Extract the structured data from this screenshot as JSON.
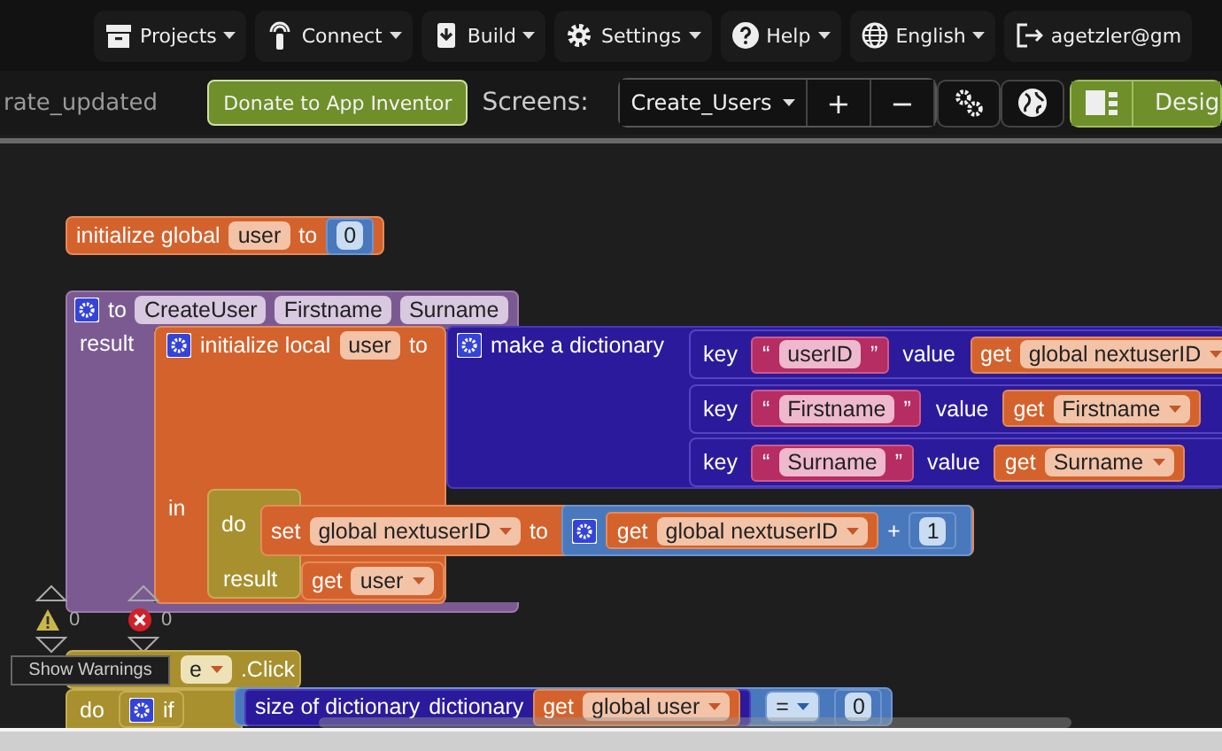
{
  "menu": [
    {
      "label": "Projects",
      "kind": "box"
    },
    {
      "label": "Connect",
      "kind": "antenna"
    },
    {
      "label": "Build",
      "kind": "download"
    },
    {
      "label": "Settings",
      "kind": "gear"
    },
    {
      "label": "Help",
      "kind": "help"
    },
    {
      "label": "English",
      "kind": "globe"
    }
  ],
  "account": {
    "label": "agetzler@gm"
  },
  "toolbar": {
    "project_name": "rate_updated",
    "donate_button": "Donate to App Inventor",
    "screens_label": "Screens:",
    "screen": "Create_Users",
    "add": "+",
    "remove": "−",
    "design_button": {
      "label": "Desig",
      "selected": true
    }
  },
  "workspace": {
    "global_var": {
      "label": "initialize global",
      "name": "user",
      "to": "to",
      "value": "0"
    },
    "procedure": {
      "to": "to",
      "name": "CreateUser",
      "params": [
        "Firstname",
        "Surname"
      ],
      "result": "result",
      "local": {
        "label": "initialize local",
        "name": "user",
        "to": "to",
        "in": "in"
      },
      "dictionary": {
        "label": "make a dictionary",
        "pairs": [
          {
            "key": "key",
            "q1": "“",
            "text": "userID",
            "q2": "”",
            "value": "value",
            "get": "get",
            "var": "global nextuserID"
          },
          {
            "key": "key",
            "q1": "“",
            "text": "Firstname",
            "q2": "”",
            "value": "value",
            "get": "get",
            "var": "Firstname"
          },
          {
            "key": "key",
            "q1": "“",
            "text": "Surname",
            "q2": "”",
            "value": "value",
            "get": "get",
            "var": "Surname"
          }
        ]
      },
      "body": {
        "do": "do",
        "set": "set",
        "var": "global nextuserID",
        "to": "to",
        "get": "get",
        "get_var": "global nextuserID",
        "op": "+",
        "num": "1",
        "result": "result",
        "result_get": "get",
        "result_var": "user"
      }
    },
    "indicators": {
      "warnings": "0",
      "errors": "0"
    },
    "tooltip": "Show Warnings",
    "event": {
      "component": "e",
      "event": ".Click",
      "do": "do",
      "if": "if",
      "size": "size of dictionary",
      "arg": "dictionary",
      "get": "get",
      "var": "global user",
      "op": "=",
      "num": "0"
    }
  }
}
